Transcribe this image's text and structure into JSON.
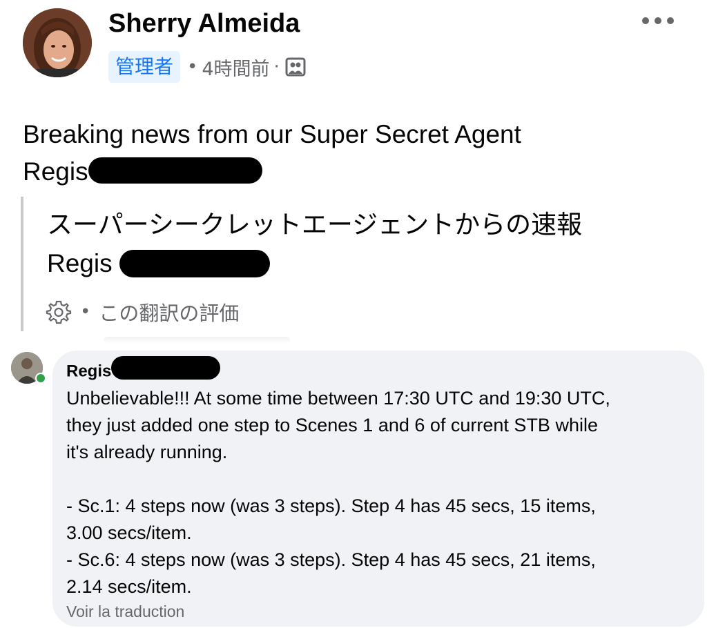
{
  "post": {
    "author": "Sherry Almeida",
    "role_badge": "管理者",
    "time": "4時間前",
    "text_before": "Breaking news from our Super Secret Agent",
    "text_name": "Regis",
    "translation_line1": "スーパーシークレットエージェントからの速報",
    "translation_name": "Regis",
    "rate_translation": "この翻訳の評価"
  },
  "comment": {
    "author": "Regis",
    "lines": [
      "Unbelievable!!! At some time between 17:30 UTC and 19:30 UTC,",
      "they just added one step to Scenes 1 and 6 of current STB while",
      "it's already running.",
      "- Sc.1: 4 steps now (was 3 steps). Step  4 has 45 secs, 15 items,",
      "3.00 secs/item.",
      "- Sc.6: 4 steps now (was 3 steps). Step  4 has 45 secs, 21 items,",
      "2.14 secs/item."
    ],
    "see_translation": "Voir la traduction"
  },
  "colors": {
    "badge_bg": "#e7f3ff",
    "badge_text": "#1877f2",
    "secondary_text": "#65676b",
    "bubble_bg": "#f0f2f5",
    "online": "#31a24c"
  }
}
